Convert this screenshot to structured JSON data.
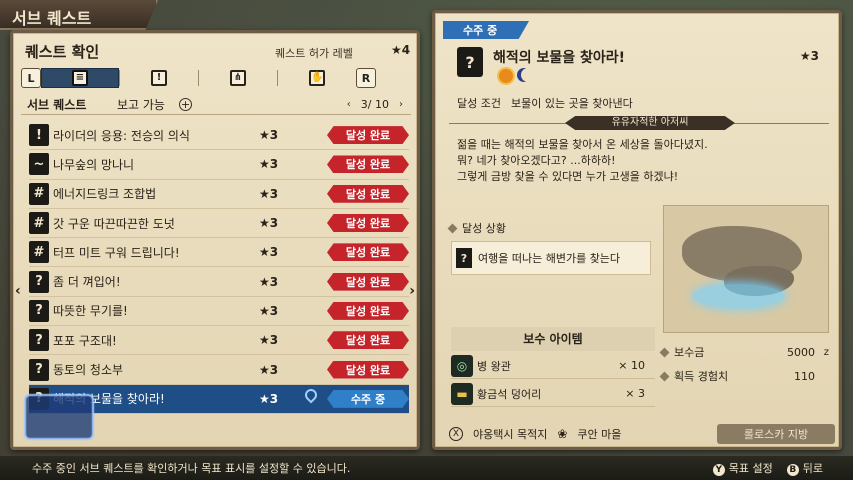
{
  "screen_title": "서브 퀘스트",
  "left": {
    "title": "퀘스트 확인",
    "level_label": "퀘스트 허가 레벨",
    "level_value": "★4",
    "tabs": [
      "L",
      "R"
    ],
    "sub_header": {
      "title": "서브 퀘스트",
      "report": "보고 가능",
      "page": "3/ 10"
    },
    "quests": [
      {
        "icon": "!",
        "name": "라이더의 응용: 전승의 의식",
        "stars": "★3",
        "status": "달성 완료"
      },
      {
        "icon": "~",
        "name": "나무숲의 망나니",
        "stars": "★3",
        "status": "달성 완료"
      },
      {
        "icon": "#",
        "name": "에너지드링크 조합법",
        "stars": "★3",
        "status": "달성 완료"
      },
      {
        "icon": "#",
        "name": "갓 구운 따끈따끈한 도넛",
        "stars": "★3",
        "status": "달성 완료"
      },
      {
        "icon": "#",
        "name": "터프 미트 구워 드립니다!",
        "stars": "★3",
        "status": "달성 완료"
      },
      {
        "icon": "?",
        "name": "좀 더 껴입어!",
        "stars": "★3",
        "status": "달성 완료"
      },
      {
        "icon": "?",
        "name": "따뜻한 무기를!",
        "stars": "★3",
        "status": "달성 완료"
      },
      {
        "icon": "?",
        "name": "포포 구조대!",
        "stars": "★3",
        "status": "달성 완료"
      },
      {
        "icon": "?",
        "name": "동토의 청소부",
        "stars": "★3",
        "status": "달성 완료"
      },
      {
        "icon": "?",
        "name": "해적의 보물을 찾아라!",
        "stars": "★3",
        "status": "수주 중"
      }
    ]
  },
  "right": {
    "status_tab": "수주 중",
    "title": "해적의 보물을 찾아라!",
    "stars": "★3",
    "condition_label": "달성 조건",
    "condition": "보물이 있는 곳을 찾아낸다",
    "client": "유유자적한 아저씨",
    "description": "젊을 때는 해적의 보물을 찾아서 온 세상을 돌아다녔지.\n뭐? 네가 찾아오겠다고? ...하하하!\n그렇게 금방 찾을 수 있다면 누가 고생을 하겠냐!",
    "progress_label": "달성 상황",
    "progress_item": "여행을 떠나는 해변가를 찾는다",
    "reward_header": "보수 아이템",
    "rewards": [
      {
        "name": "병 왕관",
        "qty": "× 10"
      },
      {
        "name": "황금석 덩어리",
        "qty": "× 3"
      }
    ],
    "stats": [
      {
        "label": "보수금",
        "value": "5000",
        "unit": "z"
      },
      {
        "label": "획득 경험치",
        "value": "110",
        "unit": ""
      }
    ],
    "bottom": {
      "btn1_key": "X",
      "btn1_label": "야옹택시 목적지",
      "btn2_label": "쿠안 마을",
      "region": "롤로스카 지방"
    }
  },
  "footer": {
    "hint": "수주 중인 서브 퀘스트를 확인하거나 목표 표시를 설정할 수 있습니다.",
    "action1_key": "Y",
    "action1_label": "목표 설정",
    "action2_key": "B",
    "action2_label": "뒤로"
  }
}
